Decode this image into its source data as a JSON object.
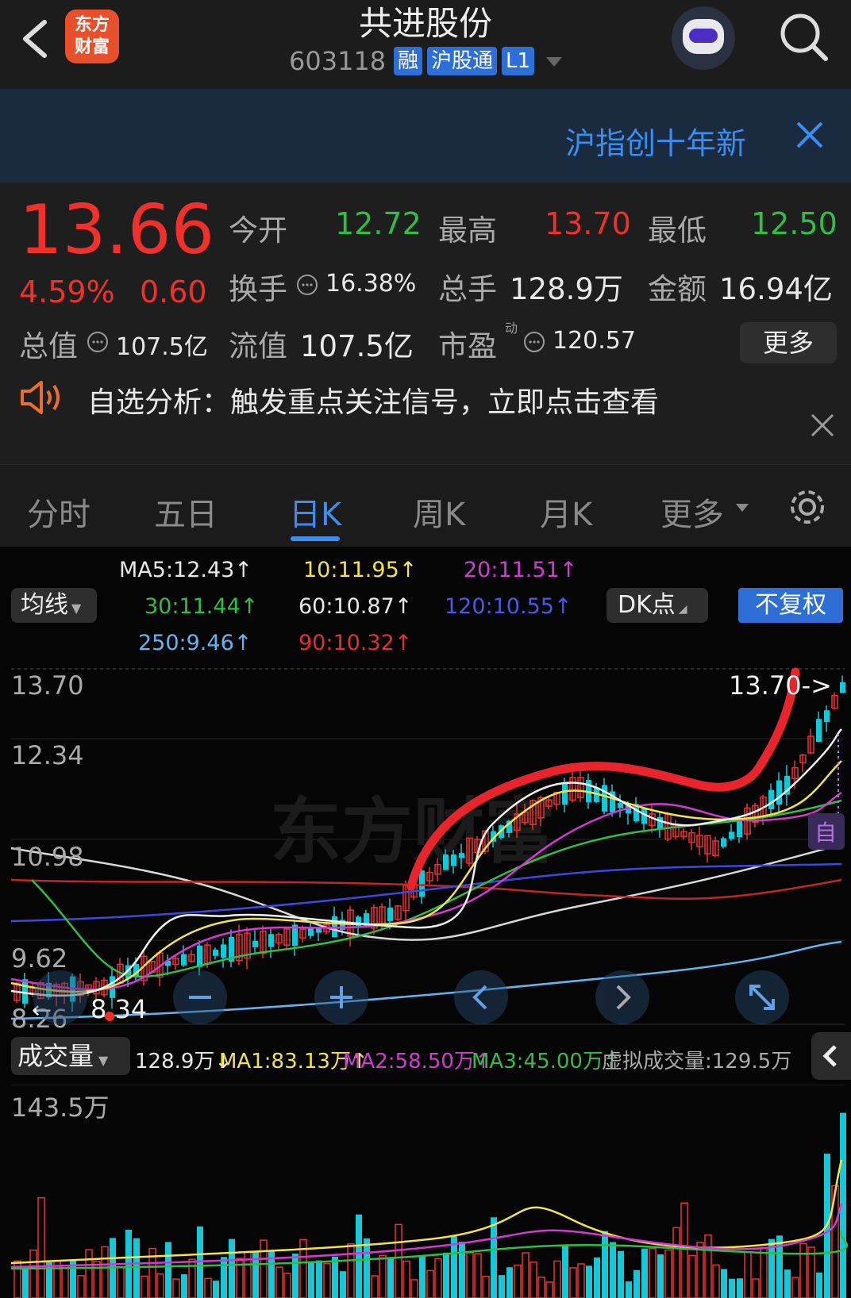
{
  "header": {
    "title": "共进股份",
    "code": "603118",
    "badges": [
      "融",
      "沪股通",
      "L1"
    ],
    "logo_line1": "东方",
    "logo_line2": "财富"
  },
  "banner": {
    "text": "沪指创十年新"
  },
  "quote": {
    "price": "13.66",
    "change_pct": "4.59%",
    "change": "0.60",
    "open_label": "今开",
    "open": "12.72",
    "high_label": "最高",
    "high": "13.70",
    "low_label": "最低",
    "low": "12.50",
    "turnover_label": "换手",
    "turnover": "16.38%",
    "volume_label": "总手",
    "volume": "128.9万",
    "amount_label": "金额",
    "amount": "16.94亿",
    "mktcap_label": "总值",
    "mktcap": "107.5亿",
    "float_label": "流值",
    "float_cap": "107.5亿",
    "pe_label": "市盈",
    "pe_sup": "动",
    "pe": "120.57",
    "more_label": "更多",
    "notice": "自选分析：触发重点关注信号，立即点击查看"
  },
  "tabs": [
    "分时",
    "五日",
    "日K",
    "周K",
    "月K",
    "更多"
  ],
  "ma_panel": {
    "ma5": "MA5:12.43↑",
    "ma10": "10:11.95↑",
    "ma20": "20:11.51↑",
    "ma30": "30:11.44↑",
    "ma60": "60:10.87↑",
    "ma120": "120:10.55↑",
    "ma250": "250:9.46↑",
    "ma90": "90:10.32↑",
    "selector": "均线",
    "dk": "DK点",
    "fq": "不复权"
  },
  "chart": {
    "y_labels": [
      "13.70",
      "12.34",
      "10.98",
      "9.62",
      "8.26"
    ],
    "high_marker": "13.70->",
    "low_marker": "8.34",
    "watermark": "东方财富",
    "side_tag": "自"
  },
  "volume": {
    "selector": "成交量",
    "vol": "128.9万↓",
    "ma1": "MA1:83.13万↑",
    "ma2": "MA2:58.50万↑",
    "ma3": "MA3:45.00万↑",
    "virtual": "虚拟成交量:129.5万",
    "top_label": "143.5万"
  },
  "colors": {
    "up": "#f0302b",
    "down": "#16c7d6",
    "accent": "#3a8ef2"
  }
}
